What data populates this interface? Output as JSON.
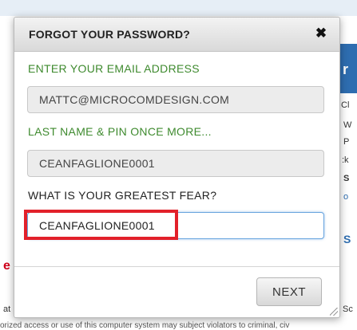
{
  "background": {
    "banner_letter": "r",
    "fragments": [
      "Cl",
      "W",
      "P",
      ":k",
      "S",
      "o",
      "S",
      "e",
      "at",
      "Sc"
    ],
    "footer_text": "orized access or use of this computer system may subject violators to criminal, civ"
  },
  "modal": {
    "title": "FORGOT YOUR PASSWORD?",
    "close_glyph": "✖",
    "email_label": "ENTER YOUR EMAIL ADDRESS",
    "email_value": "MATTC@MICROCOMDESIGN.COM",
    "name_pin_label": "LAST NAME & PIN ONCE MORE...",
    "name_pin_value": "CEANFAGLIONE0001",
    "question_label": "WHAT IS YOUR GREATEST FEAR?",
    "answer_value": "CEANFAGLIONE0001",
    "next_label": "NEXT"
  },
  "colors": {
    "label_green": "#3e8a2e",
    "highlight_red": "#e2202a",
    "active_border": "#66a3de"
  }
}
